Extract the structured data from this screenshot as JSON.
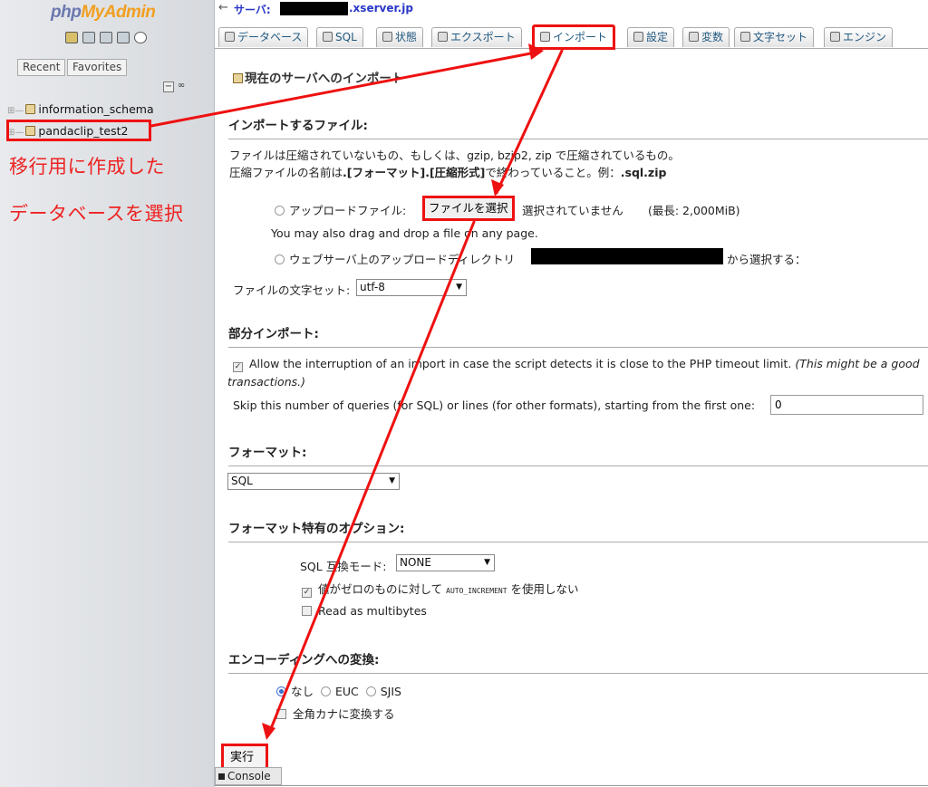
{
  "logo": {
    "part1": "php",
    "part2": "MyAdmin"
  },
  "nav": {
    "tabs": [
      "Recent",
      "Favorites"
    ],
    "databases": [
      "information_schema",
      "pandaclip_test2"
    ],
    "annotation_line1": "移行用に作成した",
    "annotation_line2": "データベースを選択"
  },
  "topbar": {
    "server_label": "サーバ:",
    "server_host": ".xserver.jp"
  },
  "menu": {
    "tabs": [
      "データベース",
      "SQL",
      "状態",
      "エクスポート",
      "インポート",
      "設定",
      "変数",
      "文字セット",
      "エンジン"
    ],
    "active": "インポート"
  },
  "page": {
    "title": "現在のサーバへのインポート",
    "file_section": {
      "heading": "インポートするファイル:",
      "note1": "ファイルは圧縮されていないもの、もしくは、gzip, bzip2, zip で圧縮されているもの。",
      "note2_a": "圧縮ファイルの名前は",
      "note2_b": ".[フォーマット].[圧縮形式]",
      "note2_c": "で終わっていること。例：",
      "note2_d": ".sql.zip",
      "upload_label": "アップロードファイル:",
      "file_button": "ファイルを選択",
      "no_file": "選択されていません",
      "max_size": "(最長: 2,000MiB)",
      "drag_note": "You may also drag and drop a file on any page.",
      "webserver_label": "ウェブサーバ上のアップロードディレクトリ",
      "webserver_suffix": "から選択する：",
      "charset_label": "ファイルの文字セット:",
      "charset_value": "utf-8"
    },
    "partial": {
      "heading": "部分インポート:",
      "allow_text": "Allow the interruption of an import in case the script detects it is close to the PHP timeout limit.",
      "allow_italic": "(This might be a good",
      "allow_italic2": "transactions.)",
      "skip_label": "Skip this number of queries (for SQL) or lines (for other formats), starting from the first one:",
      "skip_value": "0"
    },
    "format": {
      "heading": "フォーマット:",
      "value": "SQL"
    },
    "options": {
      "heading": "フォーマット特有のオプション:",
      "compat_label": "SQL 互換モード:",
      "compat_value": "NONE",
      "auto_inc_a": "値がゼロのものに対して",
      "auto_inc_code": "AUTO_INCREMENT",
      "auto_inc_b": "を使用しない",
      "multibytes": "Read as multibytes"
    },
    "encoding": {
      "heading": "エンコーディングへの変換:",
      "opt_none": "なし",
      "opt_euc": "EUC",
      "opt_sjis": "SJIS",
      "kana": "全角カナに変換する"
    },
    "go_button": "実行",
    "console": "Console"
  },
  "colors": {
    "annotation": "#ee1111",
    "link": "#2a38c8"
  }
}
